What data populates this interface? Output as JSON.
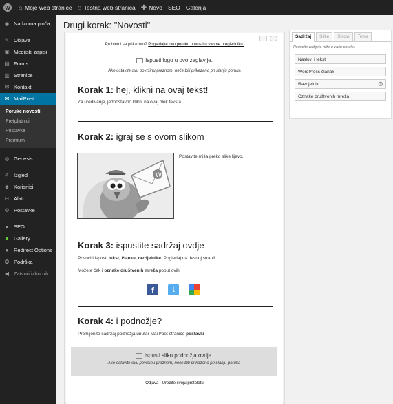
{
  "adminbar": {
    "items": [
      {
        "icon": "home-icon",
        "label": "Moje web stranice"
      },
      {
        "icon": "home-icon",
        "label": "Testna web stranica"
      },
      {
        "icon": "plus-icon",
        "label": "Novo"
      },
      {
        "label": "SEO"
      },
      {
        "label": "Galerija"
      }
    ]
  },
  "sidebar": {
    "top": [
      {
        "icon": "dashboard-icon",
        "label": "Nadzorna ploča"
      }
    ],
    "group1": [
      {
        "icon": "pin-icon",
        "label": "Objave"
      },
      {
        "icon": "media-icon",
        "label": "Medijski zapisi"
      },
      {
        "icon": "forms-icon",
        "label": "Forms"
      },
      {
        "icon": "pages-icon",
        "label": "Stranice"
      },
      {
        "icon": "comment-icon",
        "label": "Kontakt"
      }
    ],
    "active": {
      "icon": "mail-icon",
      "label": "MailPoet"
    },
    "submenu": [
      "Poruke novosti",
      "Pretplatnici",
      "Postavke",
      "Premium"
    ],
    "group2": [
      {
        "icon": "genesis-icon",
        "label": "Genesis"
      }
    ],
    "group3": [
      {
        "icon": "appearance-icon",
        "label": "Izgled"
      },
      {
        "icon": "users-icon",
        "label": "Korisnici"
      },
      {
        "icon": "tools-icon",
        "label": "Alati"
      },
      {
        "icon": "settings-icon",
        "label": "Postavke"
      }
    ],
    "group4": [
      {
        "icon": "seo-icon",
        "label": "SEO"
      },
      {
        "icon": "gallery-icon",
        "label": "Gallery"
      },
      {
        "icon": "redirect-icon",
        "label": "Redirect Options"
      },
      {
        "icon": "support-icon",
        "label": "Podrška"
      }
    ],
    "collapse": "Zatvori izbornik"
  },
  "page": {
    "title": "Drugi korak: \"Novosti\""
  },
  "editor": {
    "header_problem": "Problemi sa prikazom?",
    "header_link": "Pogledajte ovu poruku novosti u svome pregledniku.",
    "logo_drop": "Ispusti logo u ovo zaglavlje.",
    "logo_hint": "Ako ostavite ovu površinu praznom, neće biti prikazano pri slanju poruka",
    "step1_num": "Korak 1:",
    "step1_title": "hej, klikni na ovaj tekst!",
    "step1_body": "Za uređivanje, jednostavno klikni na ovaj blok teksta.",
    "step2_num": "Korak 2:",
    "step2_title": "igraj se s ovom slikom",
    "step2_body": "Postavite miša preko slike lijevo.",
    "step3_num": "Korak 3:",
    "step3_title": "ispustite sadržaj ovdje",
    "step3_body_pre": "Povuci i ispusti",
    "step3_body_bold": "tekst, članke, razdjelnike.",
    "step3_body_post": "Pogledaj na desnoj strani!",
    "step3_social_pre": "Možete čak i",
    "step3_social_bold": "oznake društvenih mreža",
    "step3_social_post": "poput ovih:",
    "step4_num": "Korak 4:",
    "step4_title": "i podnožje?",
    "step4_body_pre": "Promijenite sadržaj podnožja unutar MailPoet stranice",
    "step4_body_bold": "postavki",
    "step4_body_post": ".",
    "footer_drop": "Ispusti sliku podnožja ovdje.",
    "footer_hint": "Ako ostavite ovu površinu praznom, neće biti prikazano pri slanju poruka",
    "unsubscribe": "Odjava",
    "separator": " - ",
    "manage": "Uredite svoju pretplatu"
  },
  "panel": {
    "tabs": [
      "Sadržaj",
      "Slike",
      "Stilovi",
      "Teme"
    ],
    "hint": "Povucite widgete niže u vašu poruku.",
    "widgets": [
      "Naslovi i tekst",
      "WordPress članak",
      "Razdjelnik",
      "Oznake društvenih mreža"
    ]
  },
  "social": [
    {
      "icon": "facebook-icon",
      "letter": "f",
      "color": "#3b5998"
    },
    {
      "icon": "twitter-icon",
      "letter": "t",
      "color": "#55acee"
    },
    {
      "icon": "google-icon",
      "letter": "g",
      "color": "#dd4b39"
    }
  ]
}
